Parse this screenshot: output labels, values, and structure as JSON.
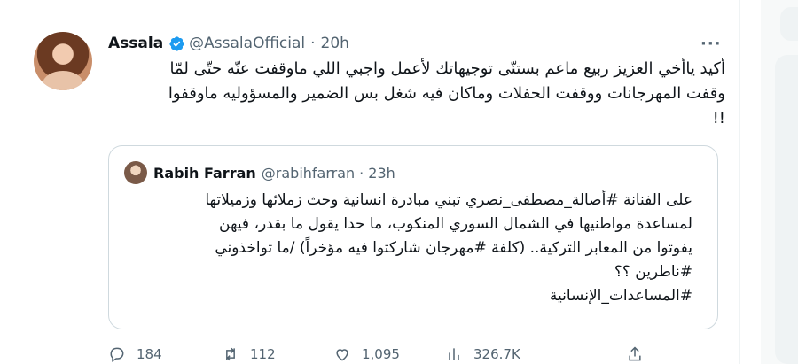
{
  "tweet": {
    "author_name": "Assala",
    "handle": "@AssalaOfficial",
    "separator": "·",
    "time": "20h",
    "more_label": "···",
    "text_lines": [
      "أكيد ياأخي العزيز ربيع ماعم بستنّى توجيهاتك لأعمل واجبي اللي ماوقفت عنّه حتّى لمّا",
      "وقفت المهرجانات ووقفت الحفلات وماكان فيه شغل بس الضمير والمسؤوليه ماوقفوا",
      "!!"
    ]
  },
  "quote": {
    "author_name": "Rabih Farran",
    "handle": "@rabihfarran",
    "separator": "·",
    "time": "23h",
    "text_lines": [
      "على الفنانة #أصالة_مصطفى_نصري تبني مبادرة انسانية وحث زملائها وزميلاتها",
      "لمساعدة مواطنيها في الشمال السوري المنكوب، ما حدا يقول ما بقدر، فيهن",
      "يفوتوا من المعابر التركية.. (كلفة #مهرجان شاركتوا فيه مؤخراً) /ما تواخذوني",
      "#ناطرين ؟؟",
      "#المساعدات_الإنسانية"
    ]
  },
  "actions": {
    "replies": "184",
    "retweets": "112",
    "likes": "1,095",
    "views": "326.7K"
  },
  "colors": {
    "verified": "#1d9bf0",
    "secondary_text": "#536471",
    "border": "#cfd9de"
  }
}
